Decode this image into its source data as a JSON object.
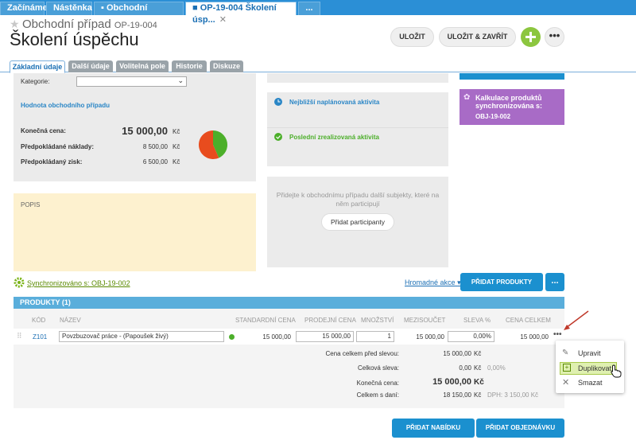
{
  "top_tabs": [
    {
      "label": "Začínáme"
    },
    {
      "label": "Nástěnka"
    },
    {
      "label": "Obchodní případy",
      "closable": true
    },
    {
      "label": "OP-19-004 Školení úsp...",
      "closable": true,
      "active": true
    },
    {
      "label": "..."
    }
  ],
  "header": {
    "type_label": "Obchodní případ",
    "code": "OP-19-004",
    "title": "Školení úspěchu",
    "save_label": "ULOŽIT",
    "save_close_label": "ULOŽIT & ZAVŘÍT",
    "add_icon": "plus",
    "more_icon": "ellipsis"
  },
  "sub_tabs": [
    "Základní údaje",
    "Další údaje",
    "Volitelná pole",
    "Historie",
    "Diskuze"
  ],
  "left": {
    "category_label": "Kategorie:",
    "category_value": "",
    "value_heading": "Hodnota obchodního případu",
    "final_price_label": "Konečná cena:",
    "final_price": "15 000,00",
    "currency": "Kč",
    "expected_costs_label": "Předpokládané náklady:",
    "expected_costs": "8 500,00",
    "expected_profit_label": "Předpokládaný zisk:",
    "expected_profit": "6 500,00",
    "pie": {
      "costs_fraction": 0.5667,
      "profit_fraction": 0.4333,
      "costs_color": "#e84c1e",
      "profit_color": "#4caf2a"
    },
    "description_label": "POPIS"
  },
  "middle": {
    "next_activity": "Nejbližší naplánovaná aktivita",
    "last_activity": "Poslední zrealizovaná aktivita",
    "participants_text": "Přidejte k obchodnímu případu další subjekty, které na něm participují",
    "add_participants": "Přidat participanty"
  },
  "right": {
    "sync_box_title": "Kalkulace produktů synchronizována s:",
    "sync_box_code": "OBJ-19-002"
  },
  "products_bar": {
    "sync_link": "Synchronizováno s: OBJ-19-002",
    "bulk_actions": "Hromadné akce",
    "add_products": "PŘIDAT PRODUKTY",
    "more": "..."
  },
  "products": {
    "heading": "PRODUKTY (1)",
    "columns": [
      "KÓD",
      "NÁZEV",
      "STANDARDNÍ CENA",
      "PRODEJNÍ CENA",
      "MNOŽSTVÍ",
      "MEZISOUČET",
      "SLEVA %",
      "CENA CELKEM"
    ],
    "rows": [
      {
        "code": "Z101",
        "name": "Povzbuzovač práce - (Papoušek živý)",
        "standard_price": "15 000,00",
        "sale_price": "15 000,00",
        "quantity": "1",
        "subtotal": "15 000,00",
        "discount": "0,00%",
        "total": "15 000,00"
      }
    ]
  },
  "summary": {
    "before_discount_label": "Cena celkem před slevou:",
    "before_discount": "15 000,00",
    "total_discount_label": "Celková sleva:",
    "total_discount": "0,00",
    "total_discount_pct": "0,00%",
    "final_label": "Konečná cena:",
    "final": "15 000,00",
    "with_tax_label": "Celkem s daní:",
    "with_tax": "18 150,00",
    "vat_label": "DPH: 3 150,00 Kč",
    "currency": "Kč"
  },
  "context_menu": {
    "edit": "Upravit",
    "duplicate": "Duplikovat",
    "delete": "Smazat"
  },
  "footer": {
    "add_offer": "PŘIDAT NABÍDKU",
    "add_order": "PŘIDAT OBJEDNÁVKU"
  }
}
